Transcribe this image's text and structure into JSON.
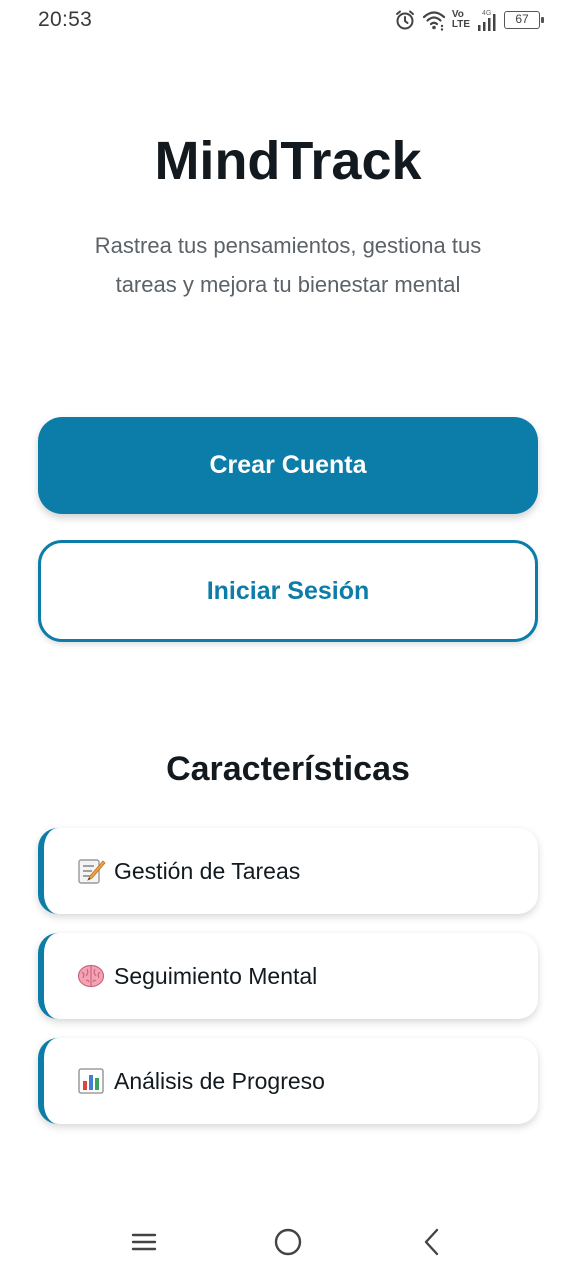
{
  "status_bar": {
    "time": "20:53",
    "network_top": "Vo",
    "network_bottom": "LTE",
    "signal_type": "4G",
    "battery": "67",
    "icons": [
      "alarm-icon",
      "wifi-icon",
      "signal-icon",
      "battery-icon"
    ]
  },
  "header": {
    "title": "MindTrack",
    "subtitle": "Rastrea tus pensamientos, gestiona tus tareas y mejora tu bienestar mental"
  },
  "actions": {
    "create_account": "Crear Cuenta",
    "login": "Iniciar Sesión"
  },
  "features": {
    "title": "Características",
    "items": [
      {
        "icon": "memo-icon",
        "label": "Gestión de Tareas"
      },
      {
        "icon": "brain-icon",
        "label": "Seguimiento Mental"
      },
      {
        "icon": "bar-chart-icon",
        "label": "Análisis de Progreso"
      }
    ]
  },
  "colors": {
    "accent": "#0b7da8",
    "text": "#121a1f",
    "muted": "#5b6268",
    "background": "#ffffff"
  },
  "nav_bar": {
    "icons": [
      "menu-icon",
      "home-icon",
      "back-icon"
    ]
  }
}
